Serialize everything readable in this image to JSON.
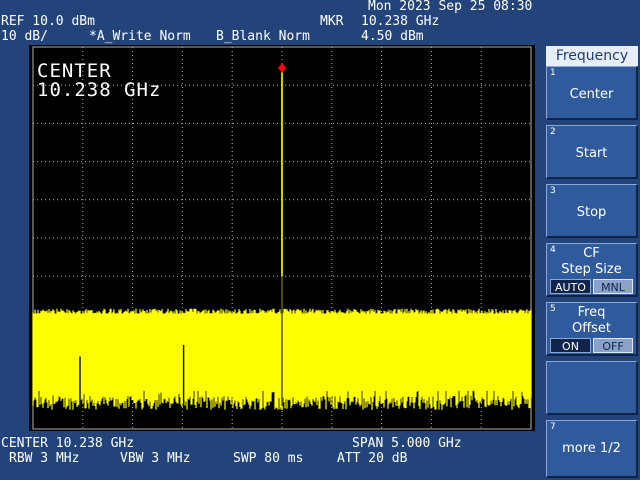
{
  "status": {
    "datetime": "Mon 2023 Sep 25 08:30"
  },
  "header": {
    "ref": "REF 10.0 dBm",
    "scale": "10 dB/",
    "trace_a": "*A_Write Norm",
    "trace_b": "B_Blank Norm",
    "marker_label": "MKR",
    "marker_freq": "10.238 GHz",
    "marker_level": "4.50 dBm"
  },
  "display": {
    "center_title": "CENTER",
    "center_value": "10.238 GHz"
  },
  "footer": {
    "center": "CENTER 10.238 GHz",
    "span": "SPAN 5.000 GHz",
    "rbw": "RBW 3 MHz",
    "vbw": "VBW 3 MHz",
    "swp": "SWP 80 ms",
    "att": "ATT 20 dB"
  },
  "menu": {
    "title": "Frequency",
    "keys": [
      {
        "num": "1",
        "label": "Center"
      },
      {
        "num": "2",
        "label": "Start"
      },
      {
        "num": "3",
        "label": "Stop"
      },
      {
        "num": "4",
        "label1": "CF",
        "label2": "Step Size",
        "opt_a": "AUTO",
        "opt_b": "MNL"
      },
      {
        "num": "5",
        "label1": "Freq",
        "label2": "Offset",
        "opt_a": "ON",
        "opt_b": "OFF"
      },
      {
        "num": "7",
        "label": "more 1/2"
      }
    ]
  },
  "spectrum": {
    "ref_level_dbm": 10,
    "db_per_div": 10,
    "center_ghz": 10.238,
    "span_ghz": 5.0,
    "peak_freq_ghz": 10.238,
    "peak_level_dbm": 4.5,
    "noise_floor_top_dbm": -59,
    "noise_floor_bottom_dbm": -85,
    "spurs": [
      {
        "freq_ghz": 8.21,
        "level_dbm": -71
      },
      {
        "freq_ghz": 9.25,
        "level_dbm": -68
      }
    ],
    "colors": {
      "trace": "#ffff00",
      "marker": "#ff0000",
      "grid": "#b0b0b0",
      "background": "#000000"
    }
  }
}
